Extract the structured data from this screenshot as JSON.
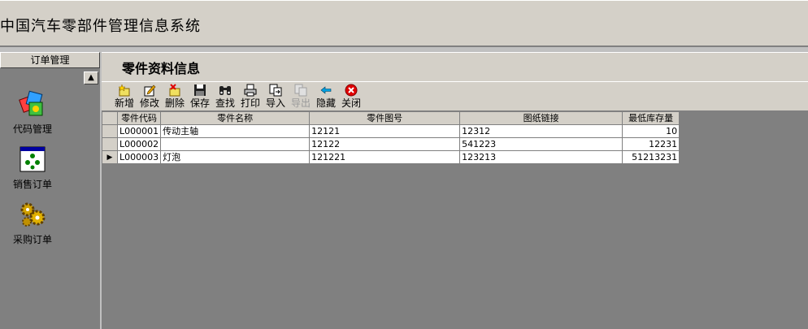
{
  "app": {
    "title": "中国汽车零部件管理信息系统"
  },
  "sidebar": {
    "header": "订单管理",
    "scroll_up_glyph": "▲",
    "items": [
      {
        "label": "代码管理",
        "icon": "code-management-icon"
      },
      {
        "label": "销售订单",
        "icon": "sales-order-icon"
      },
      {
        "label": "采购订单",
        "icon": "purchase-order-icon"
      }
    ]
  },
  "panel": {
    "title": "零件资料信息"
  },
  "toolbar": {
    "buttons": [
      {
        "label": "新增",
        "icon": "new-icon",
        "enabled": true
      },
      {
        "label": "修改",
        "icon": "edit-icon",
        "enabled": true
      },
      {
        "label": "删除",
        "icon": "delete-icon",
        "enabled": true
      },
      {
        "label": "保存",
        "icon": "save-icon",
        "enabled": true
      },
      {
        "label": "查找",
        "icon": "find-icon",
        "enabled": true
      },
      {
        "label": "打印",
        "icon": "print-icon",
        "enabled": true
      },
      {
        "label": "导入",
        "icon": "import-icon",
        "enabled": true
      },
      {
        "label": "导出",
        "icon": "export-icon",
        "enabled": false
      },
      {
        "label": "隐藏",
        "icon": "hide-icon",
        "enabled": true
      },
      {
        "label": "关闭",
        "icon": "close-icon",
        "enabled": true
      }
    ]
  },
  "grid": {
    "columns": [
      "零件代码",
      "零件名称",
      "零件图号",
      "图纸链接",
      "最低库存量"
    ],
    "current_row_glyph": "▶",
    "current_row_index": 2,
    "rows": [
      [
        "L000001",
        "传动主轴",
        "12121",
        "12312",
        "10"
      ],
      [
        "L000002",
        "",
        "12122",
        "541223",
        "12231"
      ],
      [
        "L000003",
        "灯泡",
        "121221",
        "123213",
        "51213231"
      ]
    ]
  }
}
